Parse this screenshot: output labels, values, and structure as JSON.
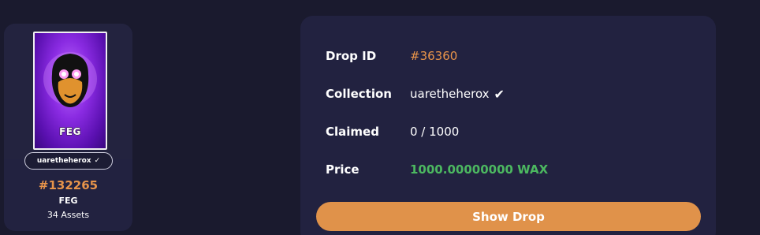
{
  "asset_card": {
    "image_label": "FEG",
    "collection": "uaretheherox",
    "collection_check": "✓",
    "asset_id": "#132265",
    "name": "FEG",
    "count": "34 Assets"
  },
  "drop": {
    "rows": [
      {
        "label": "Drop ID",
        "value": "#36360"
      },
      {
        "label": "Collection",
        "value": "uaretheherox",
        "verified": "✔"
      },
      {
        "label": "Claimed",
        "value": "0 / 1000"
      },
      {
        "label": "Price",
        "value": "1000.00000000 WAX"
      }
    ],
    "button_label": "Show Drop"
  },
  "colors": {
    "background": "#1a1a2e",
    "panel": "#222240",
    "accent_orange": "#e0924a",
    "price_green": "#4cb860",
    "art_purple": "#8a2be2"
  }
}
